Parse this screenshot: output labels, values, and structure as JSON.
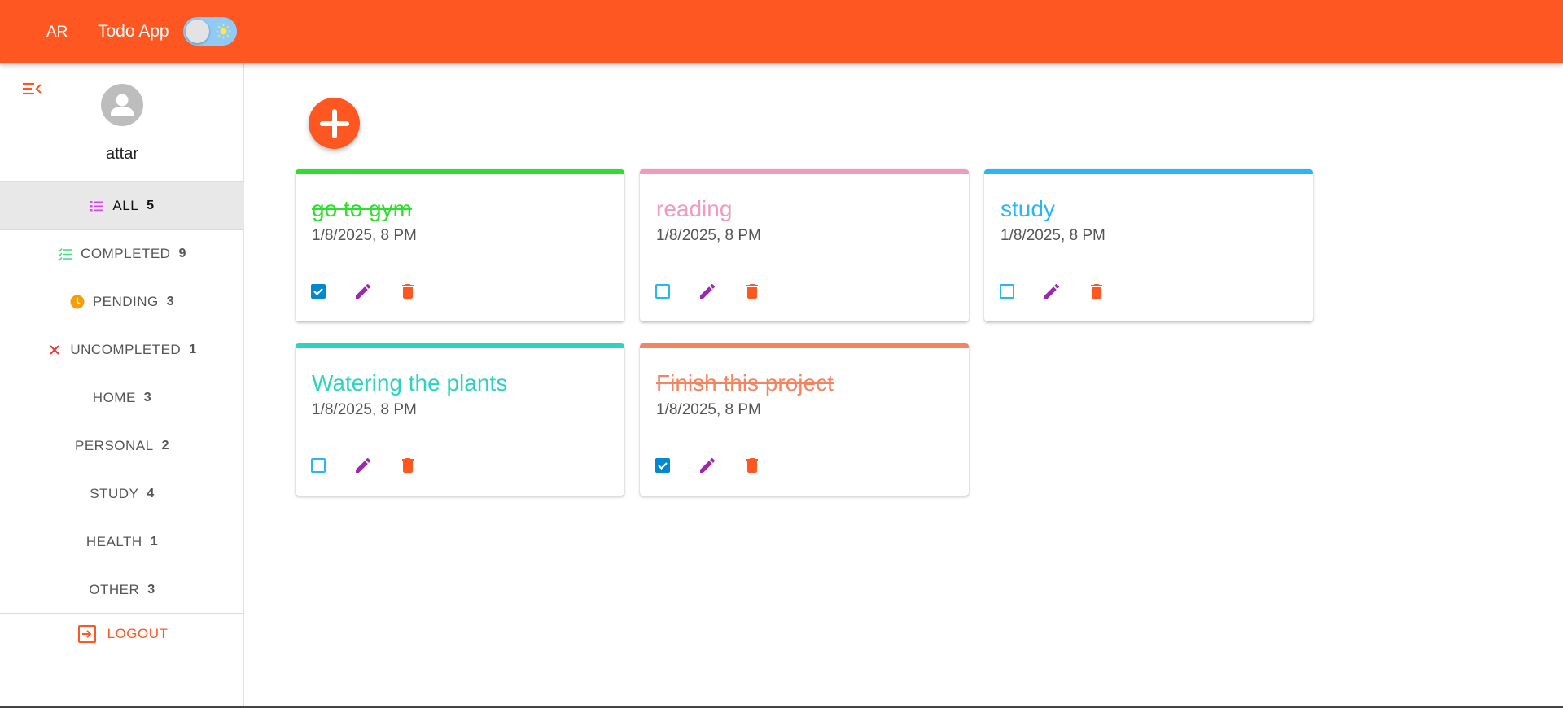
{
  "header": {
    "lang": "AR",
    "title": "Todo App"
  },
  "user": {
    "name": "attar"
  },
  "nav": [
    {
      "label": "ALL",
      "count": "5"
    },
    {
      "label": "COMPLETED",
      "count": "9"
    },
    {
      "label": "PENDING",
      "count": "3"
    },
    {
      "label": "UNCOMPLETED",
      "count": "1"
    },
    {
      "label": "HOME",
      "count": "3"
    },
    {
      "label": "PERSONAL",
      "count": "2"
    },
    {
      "label": "STUDY",
      "count": "4"
    },
    {
      "label": "HEALTH",
      "count": "1"
    },
    {
      "label": "OTHER",
      "count": "3"
    }
  ],
  "logout": "LOGOUT",
  "todos": [
    {
      "title": "go to gym",
      "date": "1/8/2025, 8 PM",
      "color": "#2ee02e",
      "completed": true
    },
    {
      "title": "reading",
      "date": "1/8/2025, 8 PM",
      "color": "#f09ac0",
      "completed": false
    },
    {
      "title": "study",
      "date": "1/8/2025, 8 PM",
      "color": "#29b6f6",
      "completed": false
    },
    {
      "title": "Watering the plants",
      "date": "1/8/2025, 8 PM",
      "color": "#2ed3c0",
      "completed": false
    },
    {
      "title": "Finish this project",
      "date": "1/8/2025, 8 PM",
      "color": "#f4845f",
      "completed": true
    }
  ],
  "colors": {
    "accent": "#ff5722",
    "edit": "#9c27b0",
    "checkbox": "#0288d1"
  }
}
